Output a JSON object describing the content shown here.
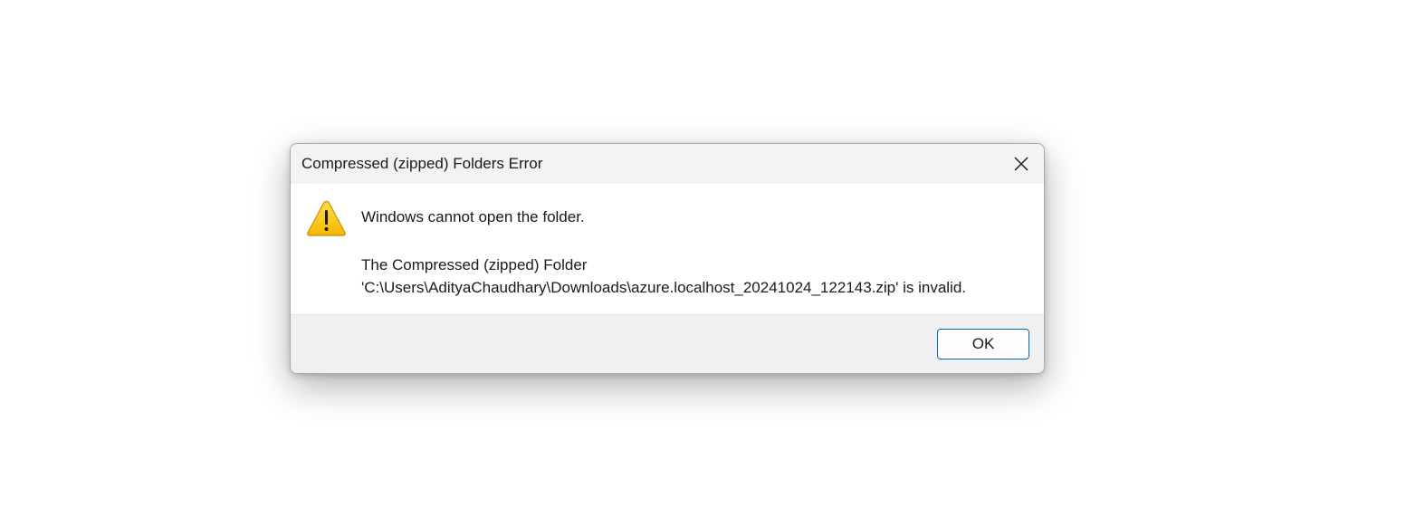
{
  "dialog": {
    "title": "Compressed (zipped) Folders Error",
    "message_main": "Windows cannot open the folder.",
    "message_detail_line1": "The Compressed (zipped) Folder",
    "message_detail_line2": "'C:\\Users\\AdityaChaudhary\\Downloads\\azure.localhost_20241024_122143.zip' is invalid.",
    "ok_label": "OK",
    "icons": {
      "close": "close-icon",
      "warning": "warning-icon"
    },
    "colors": {
      "titlebar_bg": "#f3f3f3",
      "footer_bg": "#f0f0f0",
      "button_border": "#0067c0",
      "warning_fill": "#fcc419",
      "warning_outline": "#c89200"
    }
  }
}
